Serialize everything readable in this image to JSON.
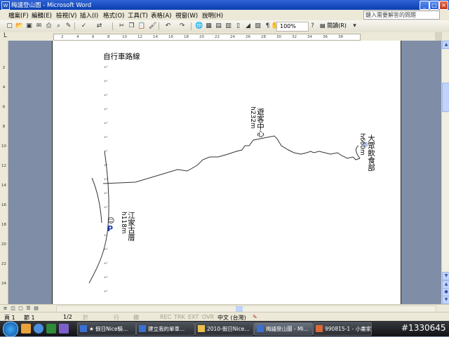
{
  "window": {
    "title": "梅議登山圖 - Microsoft Word",
    "icon": "word-app-icon"
  },
  "window_buttons": {
    "minimize": "_",
    "maximize": "□",
    "close": "×"
  },
  "menu": {
    "items": [
      "檔案(F)",
      "編輯(E)",
      "檢視(V)",
      "插入(I)",
      "格式(O)",
      "工具(T)",
      "表格(A)",
      "視窗(W)",
      "說明(H)"
    ],
    "help_placeholder": "鍵入需要解答的問題"
  },
  "toolbar": {
    "zoom": "100%",
    "reading_label": "閱讀(R)"
  },
  "ruler": {
    "h_ticks": [
      "2",
      "4",
      "6",
      "8",
      "10",
      "12",
      "14",
      "16",
      "18",
      "20",
      "22",
      "24",
      "26",
      "28",
      "30",
      "32",
      "34",
      "36",
      "38"
    ],
    "v_ticks": [
      "2",
      "4",
      "6",
      "8",
      "10",
      "12",
      "14",
      "16",
      "18",
      "20",
      "22",
      "24"
    ]
  },
  "document": {
    "title": "自行車路線",
    "paragraph_mark": "↵",
    "labels": {
      "visitor_center": "遊客中心",
      "visitor_center_height": "h232m",
      "restaurant": "大眾飲食部",
      "restaurant_height": "h660m",
      "temple": "江家古厝",
      "temple_height": "h118m",
      "parking": "P",
      "smiley": "☺"
    }
  },
  "status": {
    "page": "頁 1",
    "section": "節 1",
    "pages": "1/2",
    "position": "於",
    "line": "行",
    "column": "欄",
    "rec": "REC",
    "trk": "TRK",
    "ext": "EXT",
    "ovr": "OVR",
    "language": "中文 (台灣)"
  },
  "taskbar": {
    "tasks": [
      "★ 假日Nice騎...",
      "建立我的單車...",
      "2010-假日Nice...",
      "梅議登山圖 - Mi...",
      "990815-1 - 小畫家"
    ],
    "active_index": 3,
    "watermark": "#1330645"
  }
}
